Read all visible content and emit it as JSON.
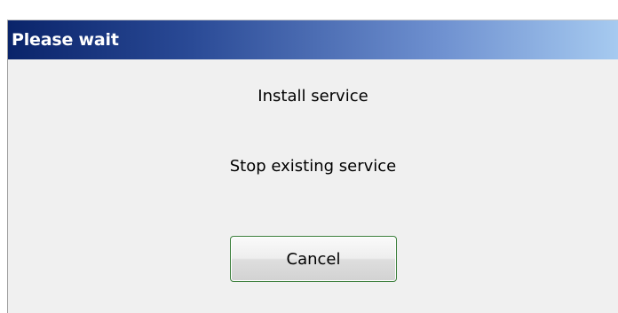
{
  "dialog": {
    "title": "Please wait",
    "status_lines": [
      "Install service",
      "Stop existing service"
    ],
    "cancel_label": "Cancel"
  },
  "colors": {
    "titlebar_start": "#0a246a",
    "titlebar_end": "#a6caf0",
    "dialog_background": "#f0f0f0",
    "button_border": "#3c7f3c"
  }
}
